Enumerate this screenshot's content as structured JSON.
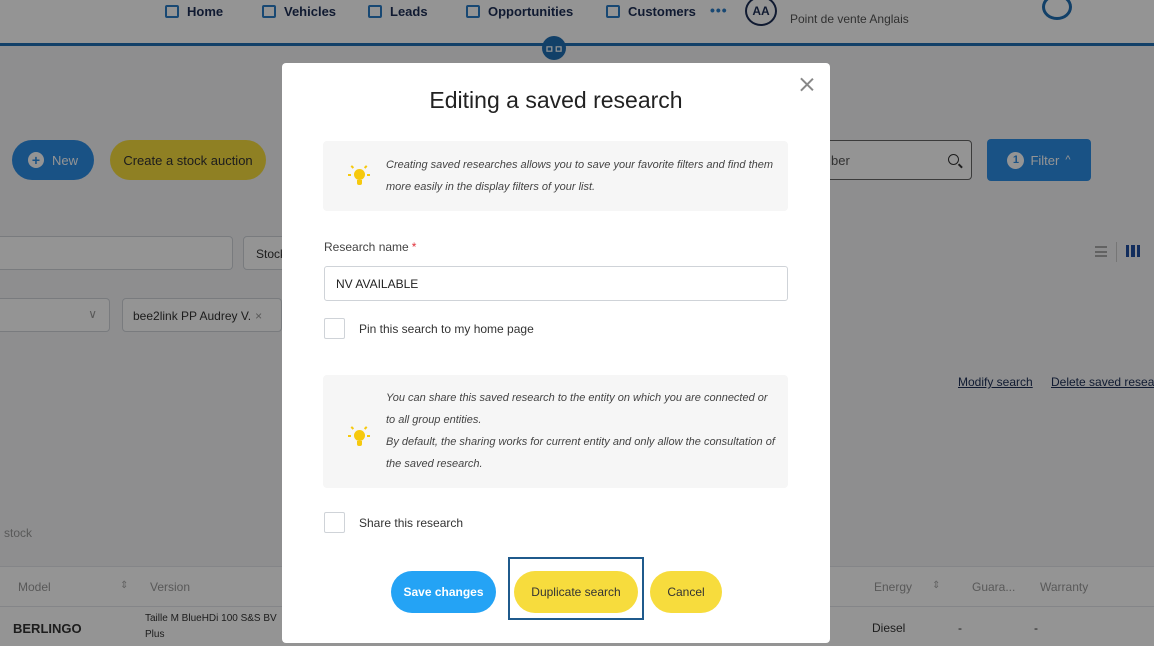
{
  "nav": {
    "items": [
      "Home",
      "Vehicles",
      "Leads",
      "Opportunities",
      "Customers"
    ],
    "more": "•••",
    "avatar": "AA",
    "point_of_sale": "Point de vente Anglais",
    "center_icon": "ㅁㅁ"
  },
  "toolbar": {
    "new_label": "New",
    "auction_label": "Create a stock auction",
    "search_placeholder_visible": "ber",
    "filter_count": "1",
    "filter_label": "Filter"
  },
  "filters": {
    "stock_field_partial": "Stock",
    "chip_label": "bee2link PP Audrey V."
  },
  "saved_search_links": {
    "modify": "Modify search",
    "delete": "Delete saved resea"
  },
  "table": {
    "caption": "stock",
    "columns": [
      "Model",
      "Version",
      "Energy",
      "Guara...",
      "Warranty"
    ],
    "rows": [
      {
        "model": "BERLINGO",
        "version_line1": "Taille M BlueHDi 100 S&S BV",
        "version_line2": "Plus",
        "energy": "Diesel",
        "guarantee": "-",
        "warranty": "-"
      }
    ]
  },
  "modal": {
    "title": "Editing a saved research",
    "info1": "Creating saved researches allows you to save your favorite filters and find them more easily in the display filters of your list.",
    "name_label": "Research name",
    "required_mark": "*",
    "name_value": "NV AVAILABLE",
    "pin_label": "Pin this search to my home page",
    "info2_line1": "You can share this saved research to the entity on which you are connected or to all group entities.",
    "info2_line2": "By default, the sharing works for current entity and only allow the consultation of the saved research.",
    "share_label": "Share this research",
    "save_label": "Save changes",
    "duplicate_label": "Duplicate search",
    "cancel_label": "Cancel"
  },
  "colors": {
    "primary_blue": "#2c8de6",
    "accent_yellow": "#f7dc3d",
    "required_red": "#e0303a",
    "focus_frame": "#1f5a8c"
  }
}
